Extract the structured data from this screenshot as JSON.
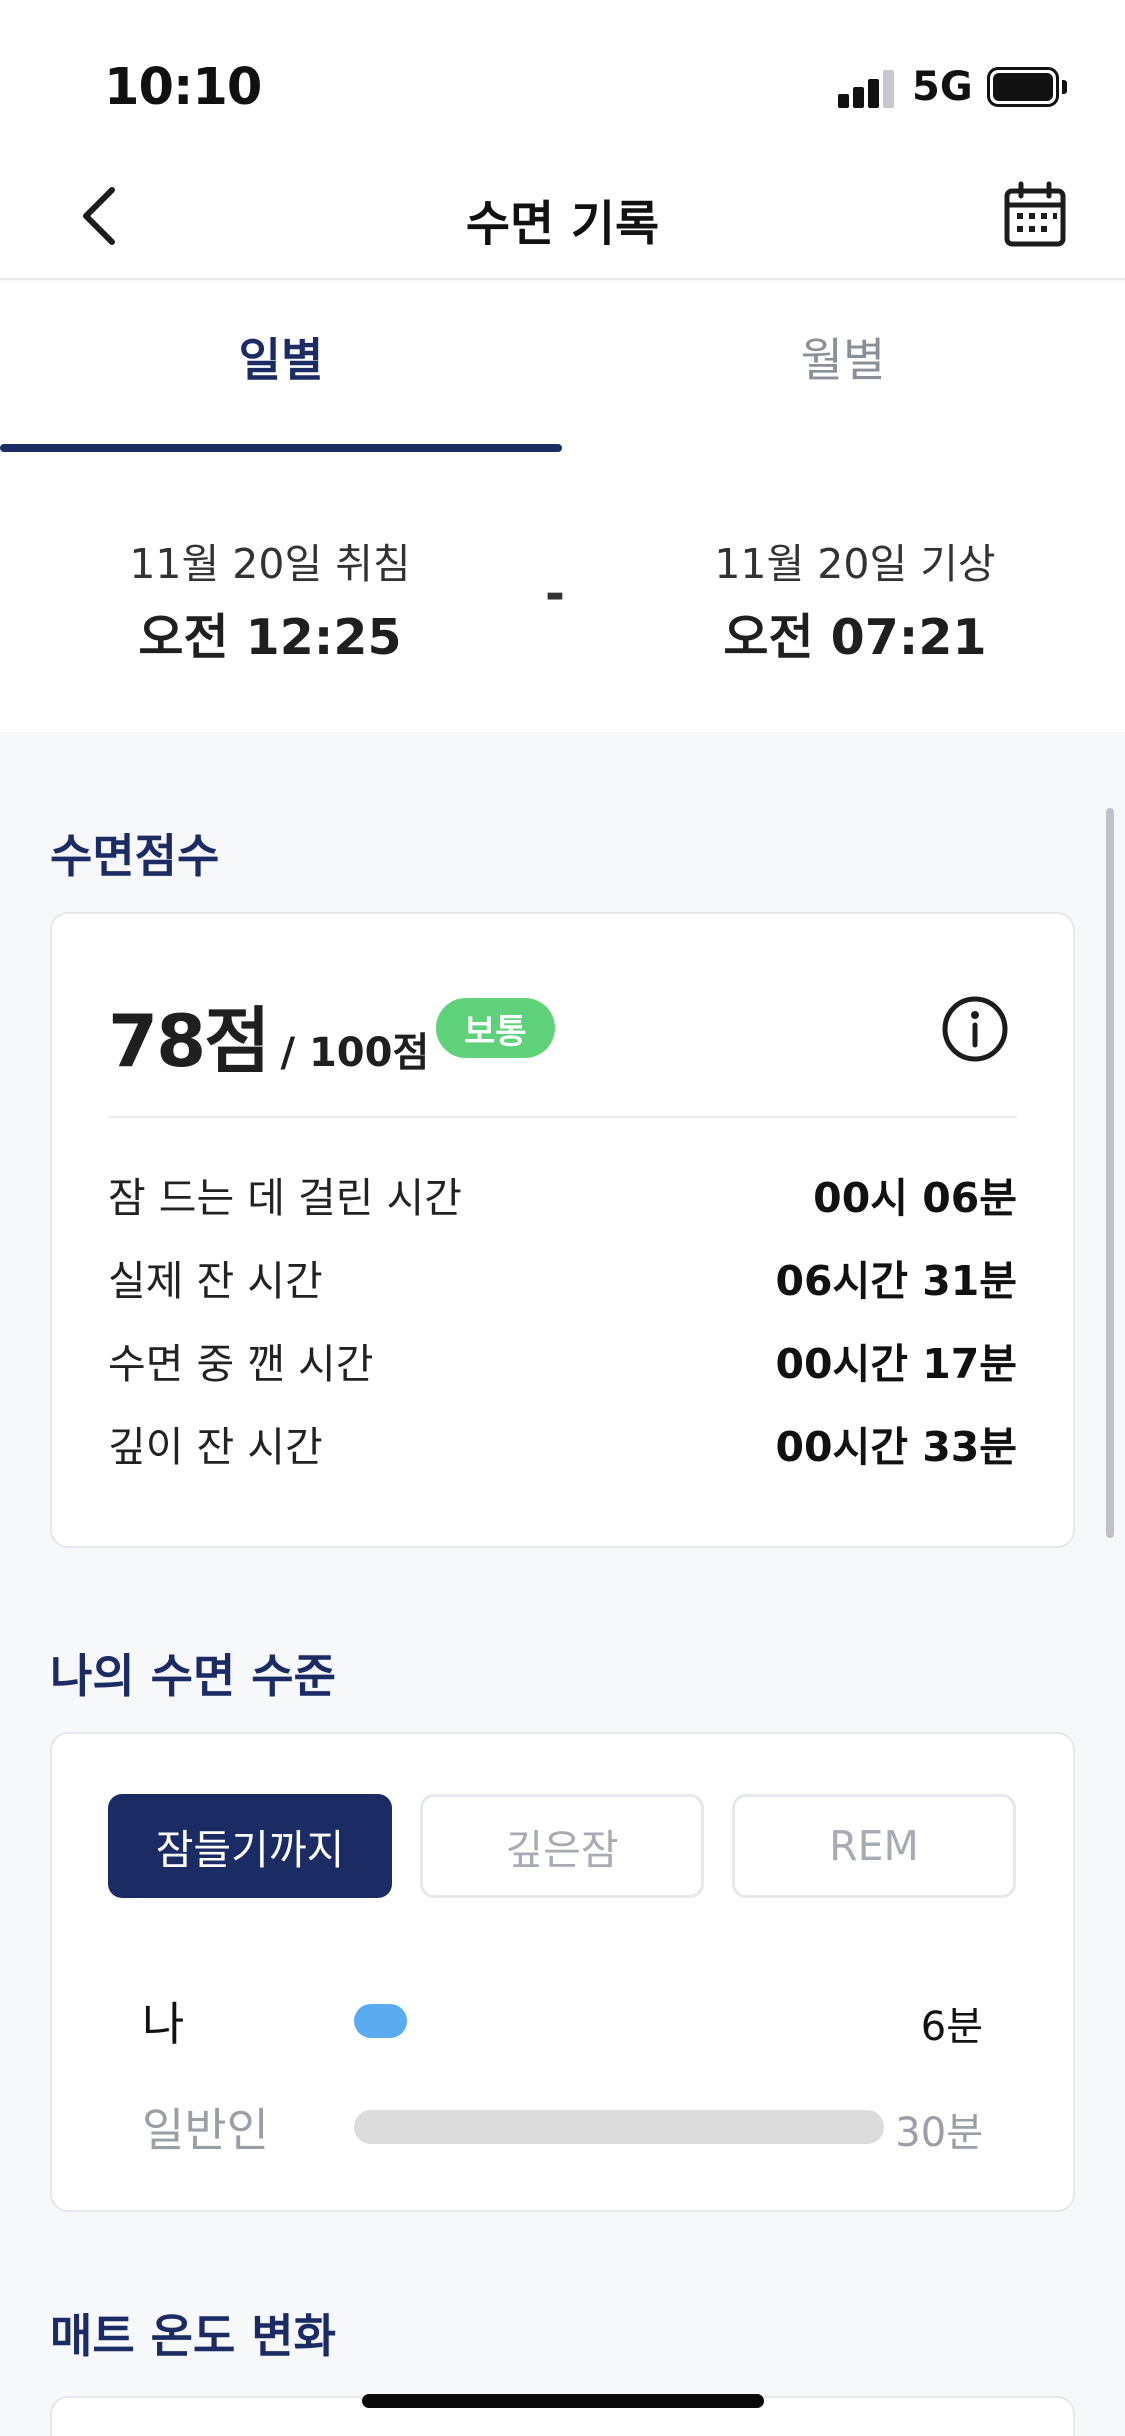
{
  "status_bar": {
    "time": "10:10",
    "network": "5G"
  },
  "header": {
    "title": "수면 기록"
  },
  "tabs": [
    {
      "label": "일별",
      "active": true
    },
    {
      "label": "월별",
      "active": false
    }
  ],
  "sleep_range": {
    "bedtime_label": "11월 20일 취침",
    "bedtime_time": "오전 12:25",
    "separator": "-",
    "wake_label": "11월 20일 기상",
    "wake_time": "오전 07:21"
  },
  "sleep_score": {
    "section_title": "수면점수",
    "score": "78점",
    "total": "/ 100점",
    "badge": "보통",
    "badge_color": "#5fd17a",
    "metrics": [
      {
        "label": "잠 드는 데 걸린 시간",
        "value": "00시 06분"
      },
      {
        "label": "실제 잔 시간",
        "value": "06시간 31분"
      },
      {
        "label": "수면 중 깬 시간",
        "value": "00시간 17분"
      },
      {
        "label": "깊이 잔 시간",
        "value": "00시간 33분"
      }
    ]
  },
  "sleep_level": {
    "section_title": "나의 수면 수준",
    "segments": [
      {
        "label": "잠들기까지",
        "active": true
      },
      {
        "label": "깊은잠",
        "active": false
      },
      {
        "label": "REM",
        "active": false
      }
    ],
    "comparison": [
      {
        "label": "나",
        "value": "6분",
        "fraction": 0.2,
        "color": "#5aabf0"
      },
      {
        "label": "일반인",
        "value": "30분",
        "fraction": 1.0,
        "color": "#dcdcdc"
      }
    ]
  },
  "mat_temperature": {
    "section_title": "매트 온도 변화"
  },
  "colors": {
    "accent": "#1b2b63",
    "badge": "#5fd17a",
    "my_bar": "#5aabf0",
    "avg_bar": "#dcdcdc"
  }
}
